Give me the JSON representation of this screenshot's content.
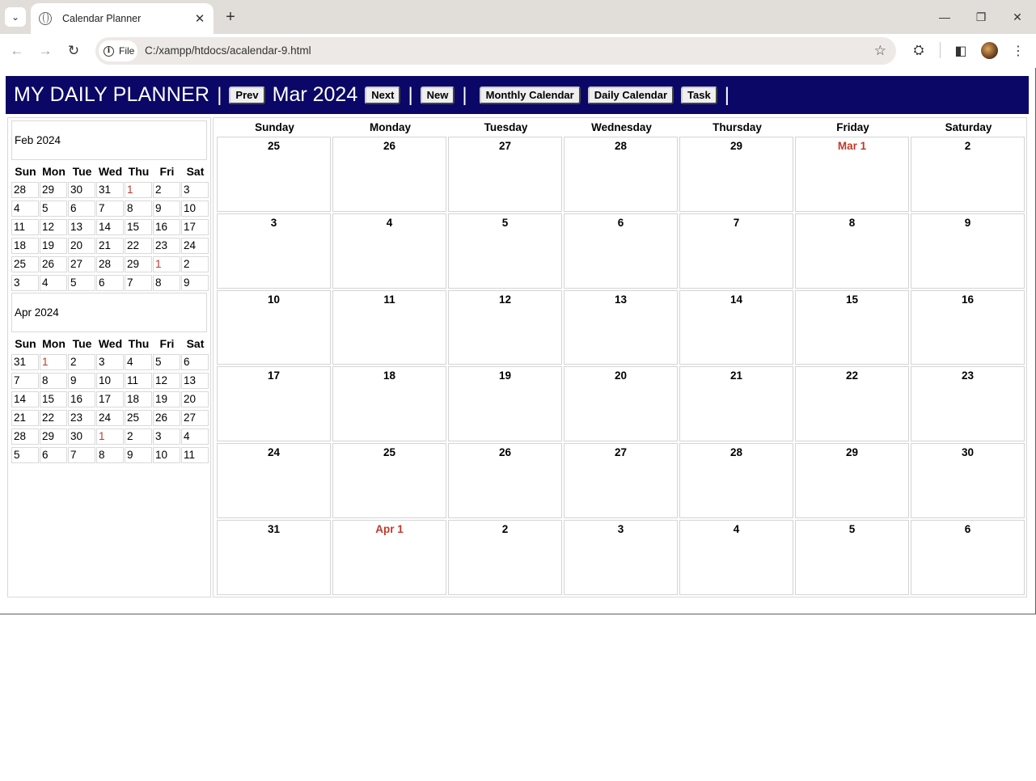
{
  "browser": {
    "tab_title": "Calendar Planner",
    "tab_close": "✕",
    "new_tab": "+",
    "chip_label": "File",
    "url": "C:/xampp/htdocs/acalendar-9.html"
  },
  "app": {
    "title": "MY DAILY PLANNER",
    "separator": "|",
    "prev_label": "Prev",
    "month_label": "Mar 2024",
    "next_label": "Next",
    "new_label": "New",
    "monthly_label": "Monthly Calendar",
    "daily_label": "Daily Calendar",
    "task_label": "Task"
  },
  "mini_days": [
    "Sun",
    "Mon",
    "Tue",
    "Wed",
    "Thu",
    "Fri",
    "Sat"
  ],
  "mini_calendars": [
    {
      "title": "Feb 2024",
      "weeks": [
        [
          "28",
          "29",
          "30",
          "31",
          "1",
          "2",
          "3"
        ],
        [
          "4",
          "5",
          "6",
          "7",
          "8",
          "9",
          "10"
        ],
        [
          "11",
          "12",
          "13",
          "14",
          "15",
          "16",
          "17"
        ],
        [
          "18",
          "19",
          "20",
          "21",
          "22",
          "23",
          "24"
        ],
        [
          "25",
          "26",
          "27",
          "28",
          "29",
          "1",
          "2"
        ],
        [
          "3",
          "4",
          "5",
          "6",
          "7",
          "8",
          "9"
        ]
      ],
      "highlight": [
        [
          0,
          4
        ],
        [
          4,
          5
        ]
      ]
    },
    {
      "title": "Apr 2024",
      "weeks": [
        [
          "31",
          "1",
          "2",
          "3",
          "4",
          "5",
          "6"
        ],
        [
          "7",
          "8",
          "9",
          "10",
          "11",
          "12",
          "13"
        ],
        [
          "14",
          "15",
          "16",
          "17",
          "18",
          "19",
          "20"
        ],
        [
          "21",
          "22",
          "23",
          "24",
          "25",
          "26",
          "27"
        ],
        [
          "28",
          "29",
          "30",
          "1",
          "2",
          "3",
          "4"
        ],
        [
          "5",
          "6",
          "7",
          "8",
          "9",
          "10",
          "11"
        ]
      ],
      "highlight": [
        [
          0,
          1
        ],
        [
          4,
          3
        ]
      ]
    }
  ],
  "main_days": [
    "Sunday",
    "Monday",
    "Tuesday",
    "Wednesday",
    "Thursday",
    "Friday",
    "Saturday"
  ],
  "main_weeks": [
    [
      "25",
      "26",
      "27",
      "28",
      "29",
      "Mar 1",
      "2"
    ],
    [
      "3",
      "4",
      "5",
      "6",
      "7",
      "8",
      "9"
    ],
    [
      "10",
      "11",
      "12",
      "13",
      "14",
      "15",
      "16"
    ],
    [
      "17",
      "18",
      "19",
      "20",
      "21",
      "22",
      "23"
    ],
    [
      "24",
      "25",
      "26",
      "27",
      "28",
      "29",
      "30"
    ],
    [
      "31",
      "Apr 1",
      "2",
      "3",
      "4",
      "5",
      "6"
    ]
  ],
  "main_highlight": [
    [
      0,
      5
    ],
    [
      5,
      1
    ]
  ],
  "colors": {
    "header_bg": "#0b0766",
    "highlight": "#c0392b"
  }
}
